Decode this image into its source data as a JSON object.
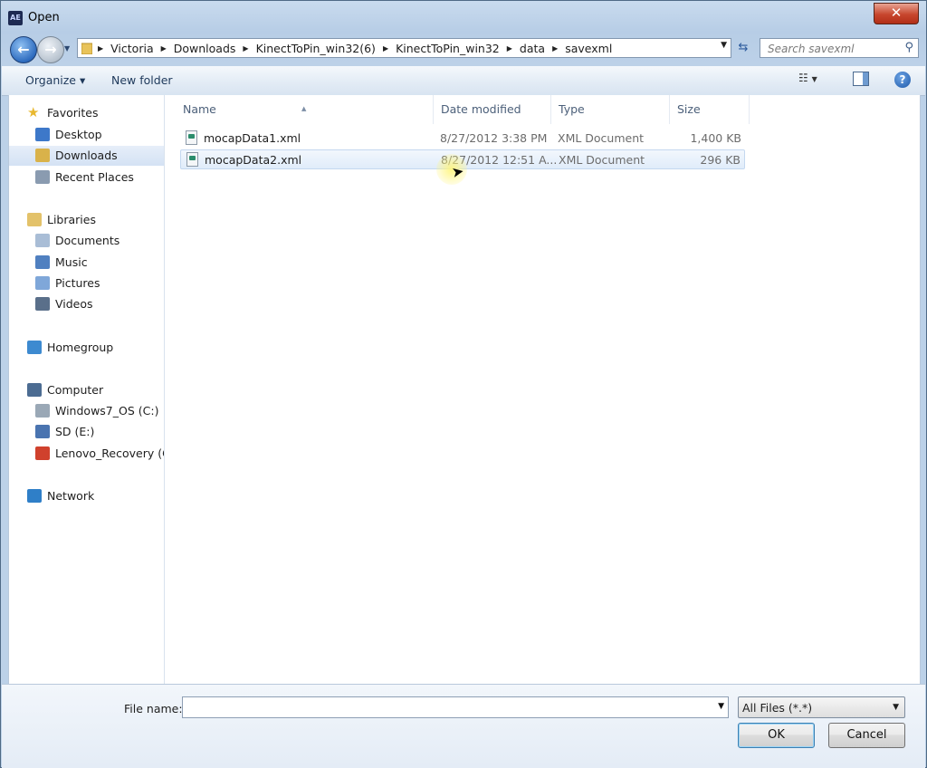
{
  "window": {
    "title": "Open",
    "app_icon_text": "AE"
  },
  "nav": {
    "breadcrumbs": [
      "Victoria",
      "Downloads",
      "KinectToPin_win32(6)",
      "KinectToPin_win32",
      "data",
      "savexml"
    ],
    "search_placeholder": "Search savexml"
  },
  "toolbar": {
    "organize": "Organize ▾",
    "new_folder": "New folder"
  },
  "sidebar": {
    "items": [
      {
        "label": "Favorites",
        "icon": "star-icon",
        "group": true
      },
      {
        "label": "Desktop",
        "icon": "desktop-icon"
      },
      {
        "label": "Downloads",
        "icon": "downloads-folder-icon",
        "selected": true
      },
      {
        "label": "Recent Places",
        "icon": "recent-places-icon"
      },
      {
        "label": "Libraries",
        "icon": "libraries-icon",
        "group": true
      },
      {
        "label": "Documents",
        "icon": "documents-icon"
      },
      {
        "label": "Music",
        "icon": "music-icon"
      },
      {
        "label": "Pictures",
        "icon": "pictures-icon"
      },
      {
        "label": "Videos",
        "icon": "videos-icon"
      },
      {
        "label": "Homegroup",
        "icon": "homegroup-icon",
        "group": true
      },
      {
        "label": "Computer",
        "icon": "computer-icon",
        "group": true
      },
      {
        "label": "Windows7_OS (C:)",
        "icon": "hard-drive-icon"
      },
      {
        "label": "SD (E:)",
        "icon": "sd-card-icon"
      },
      {
        "label": "Lenovo_Recovery (Q:",
        "icon": "recovery-drive-icon"
      },
      {
        "label": "Network",
        "icon": "network-icon",
        "group": true
      }
    ]
  },
  "columns": {
    "name": "Name",
    "date": "Date modified",
    "type": "Type",
    "size": "Size"
  },
  "files": [
    {
      "name": "mocapData1.xml",
      "date": "8/27/2012 3:38 PM",
      "type": "XML Document",
      "size": "1,400 KB",
      "selected": false
    },
    {
      "name": "mocapData2.xml",
      "date": "8/27/2012 12:51 A...",
      "type": "XML Document",
      "size": "296 KB",
      "selected": true
    }
  ],
  "footer": {
    "file_name_label": "File name:",
    "file_name_value": "",
    "filter": "All Files (*.*)",
    "ok": "OK",
    "cancel": "Cancel"
  },
  "colors": {
    "accent": "#3c7fb1",
    "selection": "#e0ecfa"
  }
}
